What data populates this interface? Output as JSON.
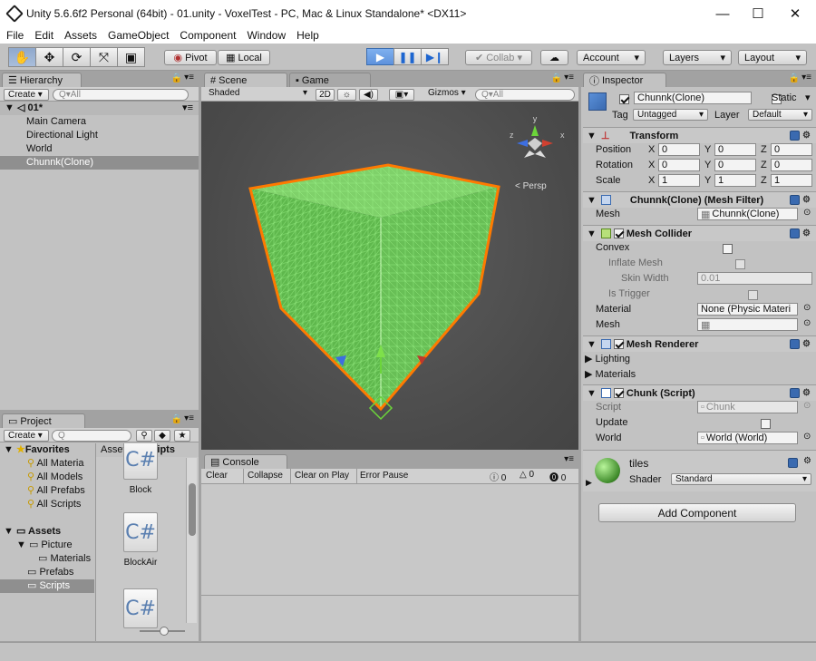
{
  "window": {
    "title": "Unity 5.6.6f2 Personal (64bit) - 01.unity - VoxelTest - PC, Mac & Linux Standalone* <DX11>",
    "controls": [
      "—",
      "☐",
      "✕"
    ]
  },
  "menu": [
    "File",
    "Edit",
    "Assets",
    "GameObject",
    "Component",
    "Window",
    "Help"
  ],
  "toolbar": {
    "pivot": "Pivot",
    "local": "Local",
    "collab": "Collab ▾",
    "account": "Account",
    "layers": "Layers",
    "layout": "Layout",
    "dropdown_arrow": "▾"
  },
  "hierarchy": {
    "tab": "Hierarchy",
    "create": "Create ▾",
    "search_placeholder": "Q▾All",
    "scene_name": "01*",
    "items": [
      "Main Camera",
      "Directional Light",
      "World",
      "Chunnk(Clone)"
    ]
  },
  "scene_view": {
    "tab_scene": "Scene",
    "tab_game": "Game",
    "shading": "Shaded",
    "mode_2d": "2D",
    "gizmos": "Gizmos ▾",
    "search_placeholder": "Q▾All",
    "persp_label": "Persp",
    "gizmo_axes": [
      "y",
      "x",
      "z"
    ]
  },
  "console": {
    "tab": "Console",
    "buttons": [
      "Clear",
      "Collapse",
      "Clear on Play",
      "Error Pause"
    ],
    "counts": {
      "info": "0",
      "warn": "0",
      "error": "0"
    }
  },
  "project": {
    "tab": "Project",
    "create": "Create ▾",
    "search_placeholder": "Q",
    "favorites_label": "Favorites",
    "favorites": [
      "All Materia",
      "All Models",
      "All Prefabs",
      "All Scripts"
    ],
    "assets_label": "Assets",
    "tree": [
      "Picture",
      "Materials",
      "Prefabs",
      "Scripts"
    ],
    "breadcrumb": [
      "Assets",
      "Scripts"
    ],
    "files": [
      "Block",
      "BlockAir",
      ""
    ]
  },
  "inspector": {
    "tab": "Inspector",
    "object_name": "Chunnk(Clone)",
    "static_label": "Static",
    "tag_label": "Tag",
    "tag_value": "Untagged",
    "layer_label": "Layer",
    "layer_value": "Default",
    "transform": {
      "title": "Transform",
      "rows": [
        {
          "label": "Position",
          "x": "0",
          "y": "0",
          "z": "0"
        },
        {
          "label": "Rotation",
          "x": "0",
          "y": "0",
          "z": "0"
        },
        {
          "label": "Scale",
          "x": "1",
          "y": "1",
          "z": "1"
        }
      ]
    },
    "mesh_filter": {
      "title": "Chunnk(Clone) (Mesh Filter)",
      "mesh_label": "Mesh",
      "mesh_value": "Chunnk(Clone)"
    },
    "mesh_collider": {
      "title": "Mesh Collider",
      "convex": "Convex",
      "inflate": "Inflate Mesh",
      "skin": "Skin Width",
      "skin_value": "0.01",
      "trigger": "Is Trigger",
      "material_label": "Material",
      "material_value": "None (Physic Materi",
      "mesh_label": "Mesh"
    },
    "mesh_renderer": {
      "title": "Mesh Renderer",
      "lighting": "Lighting",
      "materials": "Materials"
    },
    "chunk_script": {
      "title": "Chunk (Script)",
      "script_label": "Script",
      "script_value": "Chunk",
      "update_label": "Update",
      "world_label": "World",
      "world_value": "World (World)"
    },
    "material": {
      "name": "tiles",
      "shader_label": "Shader",
      "shader_value": "Standard"
    },
    "add_component": "Add Component"
  },
  "colors": {
    "selection": "#8f8f8f",
    "play_blue": "#5e92dc",
    "cube_green": "#6fc95b",
    "outline_orange": "#ff7a00"
  }
}
